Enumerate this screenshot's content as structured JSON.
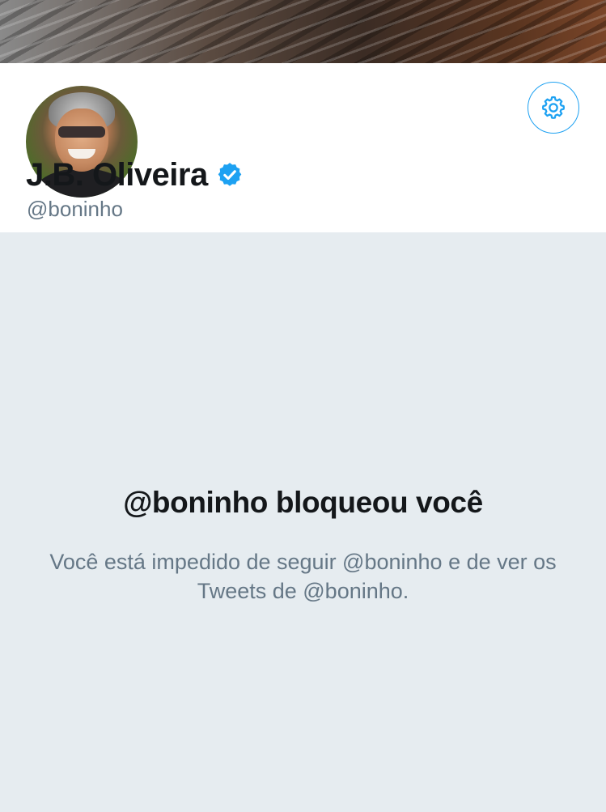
{
  "profile": {
    "display_name": "J.B. Oliveira",
    "handle": "@boninho",
    "verified": true,
    "avatar_icon": "profile-photo",
    "settings_icon": "gear-icon"
  },
  "blocked_notice": {
    "title": "@boninho bloqueou você",
    "description": "Você está impedido de seguir @boninho e de ver os Tweets de @boninho."
  },
  "colors": {
    "accent": "#1da1f2",
    "background": "#e6ecf0",
    "primary_text": "#14171a",
    "secondary_text": "#657786"
  }
}
